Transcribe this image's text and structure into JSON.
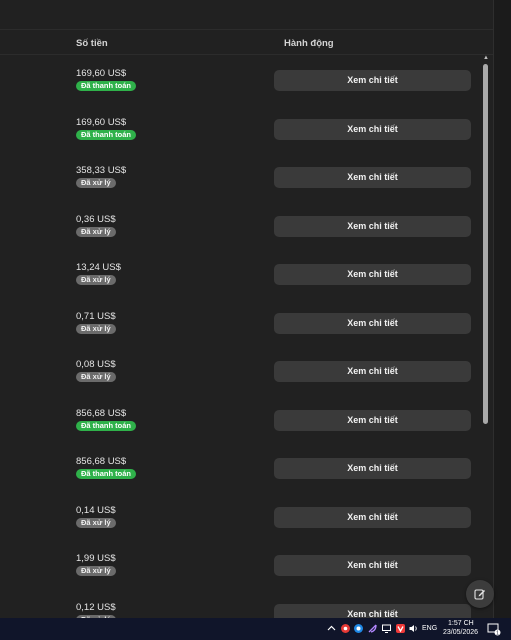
{
  "table": {
    "col_amount": "Số tiền",
    "col_action": "Hành động",
    "rows": [
      {
        "amount": "169,60 US$",
        "status": "Đã thanh toán",
        "status_type": "paid",
        "action": "Xem chi tiết"
      },
      {
        "amount": "169,60 US$",
        "status": "Đã thanh toán",
        "status_type": "paid",
        "action": "Xem chi tiết"
      },
      {
        "amount": "358,33 US$",
        "status": "Đã xử lý",
        "status_type": "done",
        "action": "Xem chi tiết"
      },
      {
        "amount": "0,36 US$",
        "status": "Đã xử lý",
        "status_type": "done",
        "action": "Xem chi tiết"
      },
      {
        "amount": "13,24 US$",
        "status": "Đã xử lý",
        "status_type": "done",
        "action": "Xem chi tiết"
      },
      {
        "amount": "0,71 US$",
        "status": "Đã xử lý",
        "status_type": "done",
        "action": "Xem chi tiết"
      },
      {
        "amount": "0,08 US$",
        "status": "Đã xử lý",
        "status_type": "done",
        "action": "Xem chi tiết"
      },
      {
        "amount": "856,68 US$",
        "status": "Đã thanh toán",
        "status_type": "paid",
        "action": "Xem chi tiết"
      },
      {
        "amount": "856,68 US$",
        "status": "Đã thanh toán",
        "status_type": "paid",
        "action": "Xem chi tiết"
      },
      {
        "amount": "0,14 US$",
        "status": "Đã xử lý",
        "status_type": "done",
        "action": "Xem chi tiết"
      },
      {
        "amount": "1,99 US$",
        "status": "Đã xử lý",
        "status_type": "done",
        "action": "Xem chi tiết"
      },
      {
        "amount": "0,12 US$",
        "status": "Đã xử lý",
        "status_type": "done",
        "action": "Xem chi tiết"
      }
    ]
  },
  "colors": {
    "background": "#212121",
    "paid_badge": "#2fb14a",
    "processed_badge": "#6b6b6b",
    "button": "#3a3a3a",
    "taskbar": "#10152a"
  },
  "compose_button": {
    "icon": "edit-icon"
  },
  "taskbar": {
    "language": "ENG",
    "time": "1:57 CH",
    "date": "23/05/2026",
    "tray_icons": [
      "chevron-up-icon",
      "record-icon",
      "browser-icon",
      "feather-icon",
      "vivaldi-icon",
      "display-icon",
      "volume-icon"
    ],
    "notification_count": "1"
  }
}
